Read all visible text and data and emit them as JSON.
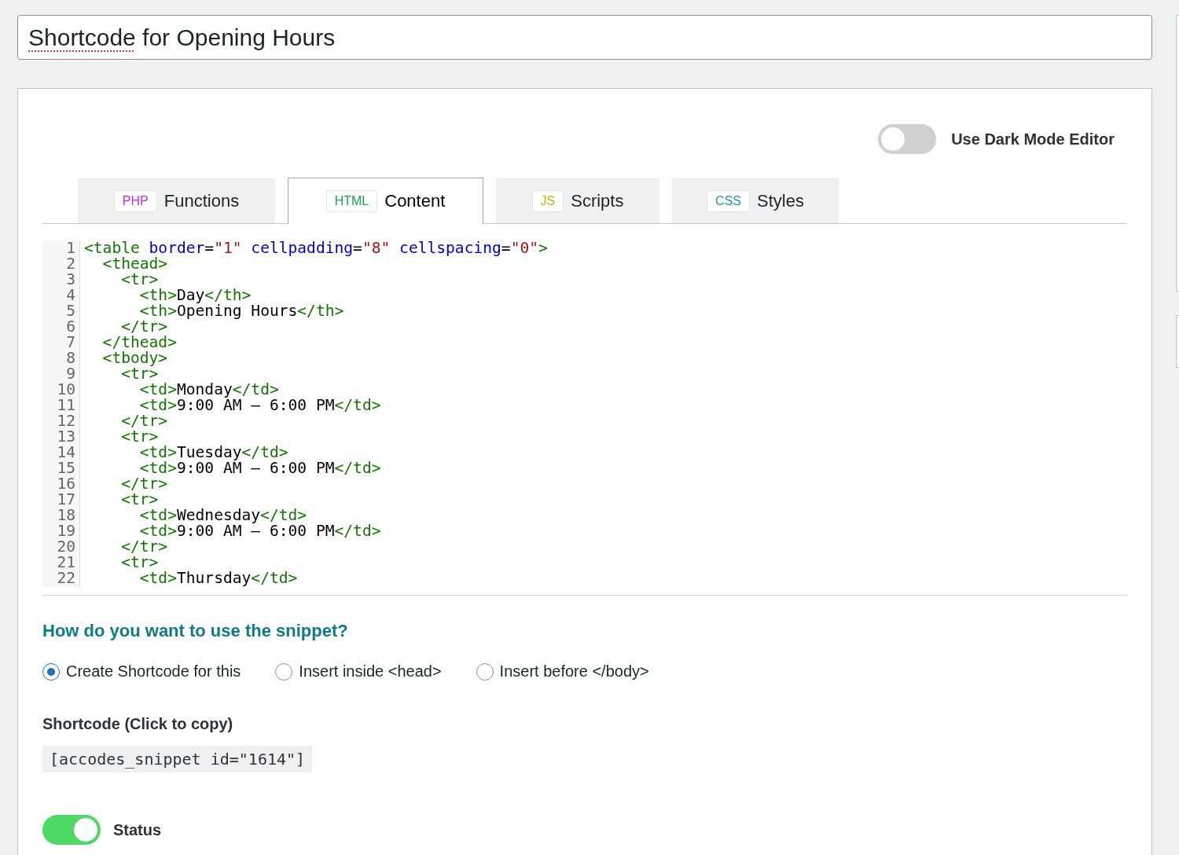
{
  "title_field": {
    "value": "Shortcode for Opening Hours",
    "first_word_flagged": true
  },
  "dark_mode": {
    "label": "Use Dark Mode Editor",
    "on": false
  },
  "tabs": [
    {
      "badge": "PHP",
      "color": "#c42bd6",
      "label": "Functions",
      "selected": false
    },
    {
      "badge": "HTML",
      "color": "#1aa34a",
      "label": "Content",
      "selected": true
    },
    {
      "badge": "JS",
      "color": "#e0a800",
      "label": "Scripts",
      "selected": false
    },
    {
      "badge": "CSS",
      "color": "#1e8fd6",
      "label": "Styles",
      "selected": false
    }
  ],
  "code_lines": [
    {
      "number": "1",
      "tokens": [
        {
          "kind": "tag",
          "text": "<table"
        },
        {
          "kind": "attr",
          "text": " border"
        },
        {
          "kind": "text",
          "text": "="
        },
        {
          "kind": "str",
          "text": "\"1\""
        },
        {
          "kind": "attr",
          "text": " cellpadding"
        },
        {
          "kind": "text",
          "text": "="
        },
        {
          "kind": "str",
          "text": "\"8\""
        },
        {
          "kind": "attr",
          "text": " cellspacing"
        },
        {
          "kind": "text",
          "text": "="
        },
        {
          "kind": "str",
          "text": "\"0\""
        },
        {
          "kind": "tag",
          "text": ">"
        }
      ]
    },
    {
      "number": "2",
      "tokens": [
        {
          "kind": "tag",
          "text": "  <thead>"
        }
      ]
    },
    {
      "number": "3",
      "tokens": [
        {
          "kind": "tag",
          "text": "    <tr>"
        }
      ]
    },
    {
      "number": "4",
      "tokens": [
        {
          "kind": "tag",
          "text": "      <th>"
        },
        {
          "kind": "text",
          "text": "Day"
        },
        {
          "kind": "tag",
          "text": "</th>"
        }
      ]
    },
    {
      "number": "5",
      "tokens": [
        {
          "kind": "tag",
          "text": "      <th>"
        },
        {
          "kind": "text",
          "text": "Opening Hours"
        },
        {
          "kind": "tag",
          "text": "</th>"
        }
      ]
    },
    {
      "number": "6",
      "tokens": [
        {
          "kind": "tag",
          "text": "    </tr>"
        }
      ]
    },
    {
      "number": "7",
      "tokens": [
        {
          "kind": "tag",
          "text": "  </thead>"
        }
      ]
    },
    {
      "number": "8",
      "tokens": [
        {
          "kind": "tag",
          "text": "  <tbody>"
        }
      ]
    },
    {
      "number": "9",
      "tokens": [
        {
          "kind": "tag",
          "text": "    <tr>"
        }
      ]
    },
    {
      "number": "10",
      "tokens": [
        {
          "kind": "tag",
          "text": "      <td>"
        },
        {
          "kind": "text",
          "text": "Monday"
        },
        {
          "kind": "tag",
          "text": "</td>"
        }
      ]
    },
    {
      "number": "11",
      "tokens": [
        {
          "kind": "tag",
          "text": "      <td>"
        },
        {
          "kind": "text",
          "text": "9:00 AM – 6:00 PM"
        },
        {
          "kind": "tag",
          "text": "</td>"
        }
      ]
    },
    {
      "number": "12",
      "tokens": [
        {
          "kind": "tag",
          "text": "    </tr>"
        }
      ]
    },
    {
      "number": "13",
      "tokens": [
        {
          "kind": "tag",
          "text": "    <tr>"
        }
      ]
    },
    {
      "number": "14",
      "tokens": [
        {
          "kind": "tag",
          "text": "      <td>"
        },
        {
          "kind": "text",
          "text": "Tuesday"
        },
        {
          "kind": "tag",
          "text": "</td>"
        }
      ]
    },
    {
      "number": "15",
      "tokens": [
        {
          "kind": "tag",
          "text": "      <td>"
        },
        {
          "kind": "text",
          "text": "9:00 AM – 6:00 PM"
        },
        {
          "kind": "tag",
          "text": "</td>"
        }
      ]
    },
    {
      "number": "16",
      "tokens": [
        {
          "kind": "tag",
          "text": "    </tr>"
        }
      ]
    },
    {
      "number": "17",
      "tokens": [
        {
          "kind": "tag",
          "text": "    <tr>"
        }
      ]
    },
    {
      "number": "18",
      "tokens": [
        {
          "kind": "tag",
          "text": "      <td>"
        },
        {
          "kind": "text",
          "text": "Wednesday"
        },
        {
          "kind": "tag",
          "text": "</td>"
        }
      ]
    },
    {
      "number": "19",
      "tokens": [
        {
          "kind": "tag",
          "text": "      <td>"
        },
        {
          "kind": "text",
          "text": "9:00 AM – 6:00 PM"
        },
        {
          "kind": "tag",
          "text": "</td>"
        }
      ]
    },
    {
      "number": "20",
      "tokens": [
        {
          "kind": "tag",
          "text": "    </tr>"
        }
      ]
    },
    {
      "number": "21",
      "tokens": [
        {
          "kind": "tag",
          "text": "    <tr>"
        }
      ]
    },
    {
      "number": "22",
      "tokens": [
        {
          "kind": "tag",
          "text": "      <td>"
        },
        {
          "kind": "text",
          "text": "Thursday"
        },
        {
          "kind": "tag",
          "text": "</td>"
        }
      ]
    }
  ],
  "usage": {
    "question": "How do you want to use the snippet?",
    "options": [
      {
        "label": "Create Shortcode for this",
        "selected": true
      },
      {
        "label": "Insert inside <head>",
        "selected": false
      },
      {
        "label": "Insert before </body>",
        "selected": false
      }
    ]
  },
  "shortcode": {
    "label": "Shortcode (Click to copy)",
    "value": "[accodes_snippet id=\"1614\"]"
  },
  "status": {
    "label": "Status",
    "on": true
  }
}
